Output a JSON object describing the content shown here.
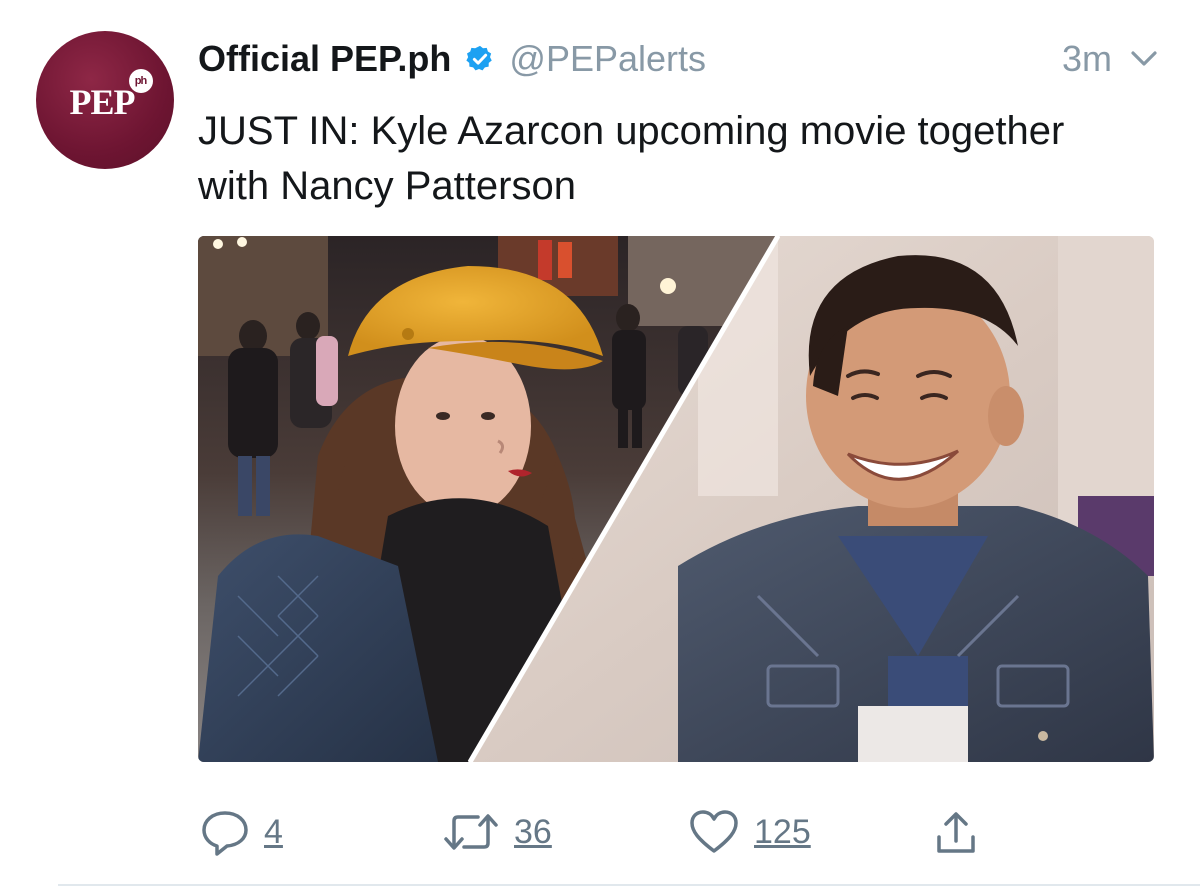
{
  "tweet": {
    "avatar_text": "PEP",
    "avatar_badge": "ph",
    "display_name": "Official PEP.ph",
    "handle": "@PEPalerts",
    "time": "3m",
    "text": "JUST IN: Kyle Azarcon upcoming movie together with Nancy Patterson",
    "media_description_icon": "photo-collage",
    "actions": {
      "reply_count": "4",
      "retweet_count": "36",
      "like_count": "125"
    }
  },
  "colors": {
    "brand": "#6e1532",
    "verified": "#1da1f2",
    "muted": "#8899a6",
    "action": "#657786"
  },
  "icons": [
    "verified-icon",
    "chevron-down-icon",
    "reply-icon",
    "retweet-icon",
    "like-icon",
    "share-icon"
  ]
}
